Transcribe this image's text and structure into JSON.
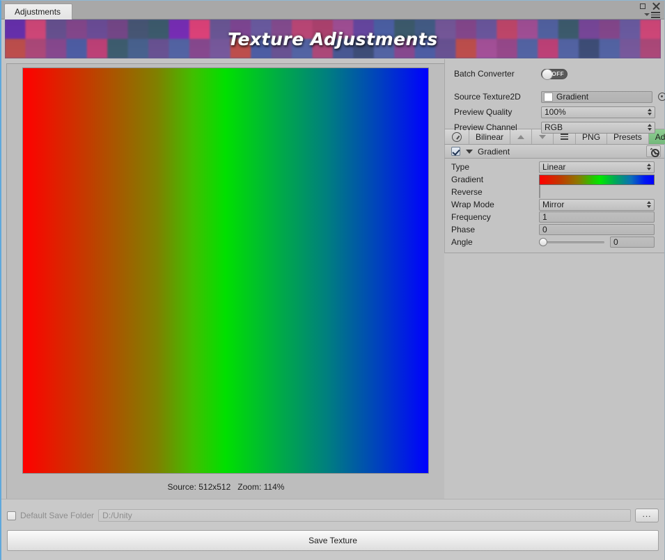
{
  "window": {
    "tab_label": "Adjustments",
    "maximize_icon": "maximize-icon",
    "close_icon": "close-icon",
    "menu_icon": "hamburger-menu-icon"
  },
  "banner": {
    "title": "Texture Adjustments",
    "tile_colors_row1": [
      "#6b32b4",
      "#d94a7e",
      "#6b5496",
      "#8a4a92",
      "#70509e",
      "#7a4a8e",
      "#4a5a7a",
      "#3f5f72",
      "#7d2fbe",
      "#e8457f",
      "#6f5a9c",
      "#84499a",
      "#6f5fa8",
      "#8a4f96",
      "#c44a7c",
      "#b54574",
      "#a8529c",
      "#6b4aa8",
      "#4f64ac",
      "#3f5f72",
      "#46608c",
      "#7a5ba0",
      "#8a4a92",
      "#6f5aa4",
      "#c8496f",
      "#a8529c",
      "#5566a8",
      "#3f5f72",
      "#7d4aa0",
      "#8a4a92",
      "#6f5fa8",
      "#d94a7e"
    ],
    "tile_colors_row2": [
      "#c2504e",
      "#b04a7c",
      "#8a4a92",
      "#4f5fa8",
      "#c2427a",
      "#3f5f72",
      "#4a6492",
      "#6b5496",
      "#5566a8",
      "#8a4a92",
      "#7a5ba0",
      "#c2504e",
      "#4f5fa8",
      "#6b5496",
      "#5566a8",
      "#b04a7c",
      "#4a5a96",
      "#3f4f7a",
      "#5566a8",
      "#8a4a92",
      "#4f5fa8",
      "#6b5496",
      "#c2504e",
      "#a8529c",
      "#9a4a8e",
      "#5566a8",
      "#c2427a",
      "#5566a8",
      "#3f4f7a",
      "#5566a8",
      "#7a5ba0",
      "#b04a7c"
    ]
  },
  "preview": {
    "status": "Source: 512x512   Zoom: 114%",
    "gradient_description": "red-to-green-to-blue horizontal linear gradient"
  },
  "inspector": {
    "batch_converter": {
      "label": "Batch Converter",
      "toggle_state": "OFF"
    },
    "source_texture": {
      "label": "Source Texture2D",
      "value": "Gradient",
      "picker_icon": "object-picker-icon"
    },
    "preview_quality": {
      "label": "Preview Quality",
      "value": "100%"
    },
    "preview_channel": {
      "label": "Preview Channel",
      "value": "RGB"
    },
    "toolbar": {
      "gauge_icon": "gauge-icon",
      "filter_mode": "Bilinear",
      "move_up_icon": "arrow-up-icon",
      "move_down_icon": "arrow-down-icon",
      "menu_icon": "list-menu-icon",
      "format": "PNG",
      "presets": "Presets",
      "add": "Add"
    },
    "component": {
      "enabled": true,
      "name": "Gradient",
      "settings_icon": "gear-icon",
      "properties": [
        {
          "label": "Type",
          "kind": "popup",
          "value": "Linear"
        },
        {
          "label": "Gradient",
          "kind": "gradient",
          "value": ""
        },
        {
          "label": "Reverse",
          "kind": "checkbox",
          "value": ""
        },
        {
          "label": "Wrap Mode",
          "kind": "popup",
          "value": "Mirror"
        },
        {
          "label": "Frequency",
          "kind": "text",
          "value": "1"
        },
        {
          "label": "Phase",
          "kind": "text",
          "value": "0"
        },
        {
          "label": "Angle",
          "kind": "slider",
          "value": "0"
        }
      ]
    }
  },
  "footer": {
    "default_save_folder_label": "Default Save Folder",
    "save_path": "D:/Unity",
    "browse_label": "...",
    "save_button": "Save Texture"
  }
}
